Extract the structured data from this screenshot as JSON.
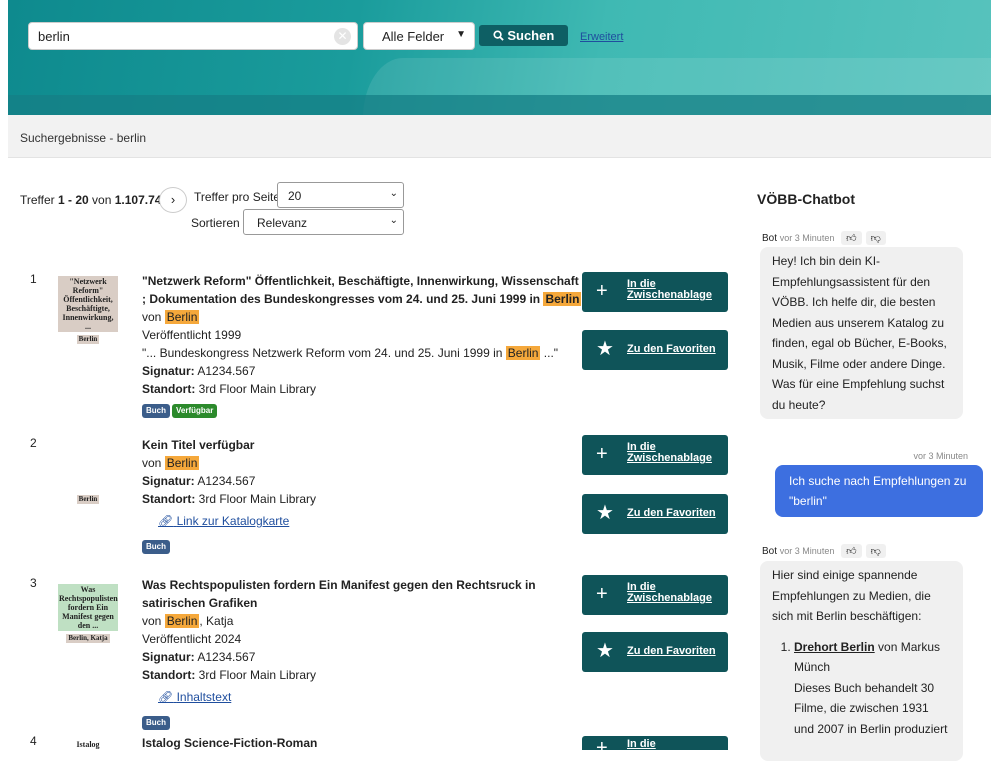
{
  "search": {
    "query": "berlin",
    "clear_icon": "✕",
    "field": "Alle Felder",
    "button": "Suchen",
    "advanced": "Erweitert"
  },
  "breadcrumb": "Suchergebnisse - berlin",
  "results_info": {
    "prefix": "Treffer ",
    "range": "1 - 20",
    "mid": " von ",
    "total": "1.107.744",
    "per_page_label": "Treffer pro Seite",
    "per_page": "20",
    "sort_label": "Sortieren",
    "sort": "Relevanz"
  },
  "actions": {
    "clipboard": [
      "In die",
      "Zwischenablage"
    ],
    "favorites": "Zu den Favoriten"
  },
  "results": [
    {
      "num": "1",
      "cover_title": "\"Netzwerk Reform\" Öffentlichkeit, Beschäftigte, Innenwirkung, ...",
      "cover_author": "Berlin",
      "title": "\"Netzwerk Reform\" Öffentlichkeit, Beschäftigte, Innenwirkung, Wissenschaft ; Dokumentation des Bundeskongresses vom 24. und 25. Juni 1999 in ",
      "title_hl": "Berlin",
      "by": "von ",
      "author": "Berlin",
      "published": "Veröffentlicht 1999",
      "snippet_pre": "\"... Bundeskongress Netzwerk Reform vom 24. und 25. Juni 1999 in ",
      "snippet_hl": "Berlin",
      "snippet_post": " ...\"",
      "signatur_label": "Signatur:",
      "signatur": "A1234.567",
      "standort_label": "Standort:",
      "standort": "3rd Floor Main Library",
      "badges": [
        "Buch",
        "Verfügbar"
      ]
    },
    {
      "num": "2",
      "cover_author": "Berlin",
      "title": "Kein Titel verfügbar",
      "by": "von ",
      "author": "Berlin",
      "signatur_label": "Signatur:",
      "signatur": "A1234.567",
      "standort_label": "Standort:",
      "standort": "3rd Floor Main Library",
      "link": "Link zur Katalogkarte",
      "badges": [
        "Buch"
      ]
    },
    {
      "num": "3",
      "cover_title": "Was Rechtspopulisten fordern Ein Manifest gegen den ...",
      "cover_author": "Berlin, Katja",
      "title": "Was Rechtspopulisten fordern Ein Manifest gegen den Rechtsruck in satirischen Grafiken",
      "by": "von ",
      "author": "Berlin",
      "author_rest": ", Katja",
      "published": "Veröffentlicht 2024",
      "signatur_label": "Signatur:",
      "signatur": "A1234.567",
      "standort_label": "Standort:",
      "standort": "3rd Floor Main Library",
      "link": "Inhaltstext",
      "badges": [
        "Buch"
      ]
    },
    {
      "num": "4",
      "cover_title": "Istalog",
      "title": "Istalog Science-Fiction-Roman"
    }
  ],
  "chat": {
    "title": "VÖBB-Chatbot",
    "bot_label": "Bot",
    "time": "vor 3 Minuten",
    "msg1": "Hey! Ich bin dein KI-Empfehlungsassistent für den VÖBB. Ich helfe dir, die besten Medien aus unserem Katalog zu finden, egal ob Bücher, E-Books, Musik, Filme oder andere Dinge. Was für eine Empfehlung suchst du heute?",
    "user_msg": "Ich suche nach Empfehlungen zu \"berlin\"",
    "msg2_intro": "Hier sind einige spannende Empfehlungen zu Medien, die sich mit Berlin beschäftigen:",
    "rec1_title": "Drehort Berlin",
    "rec1_by": " von Markus Münch",
    "rec1_desc": "Dieses Buch behandelt 30 Filme, die zwischen 1931 und 2007 in Berlin produziert"
  }
}
